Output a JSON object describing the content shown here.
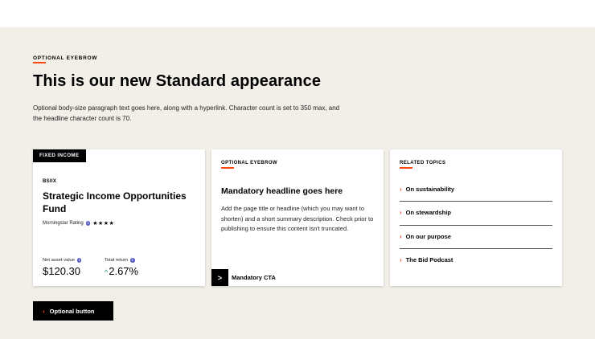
{
  "section": {
    "eyebrow": "OPTIONAL EYEBROW",
    "headline": "This is our new Standard appearance",
    "body": "Optional body-size paragraph text goes here, along with a hyperlink. Character count is set to 350 max, and the headline character count is 70."
  },
  "fund_card": {
    "tag": "FIXED INCOME",
    "ticker": "BSIIX",
    "name": "Strategic Income Opportunities Fund",
    "rating_label": "Morningstar Rating",
    "rating_stars": "★★★★",
    "rating_value": 4,
    "nav_label": "Net asset value",
    "nav_value": "$120.30",
    "return_label": "Total return",
    "return_value": "2.67%"
  },
  "article_card": {
    "eyebrow": "OPTIONAL EYEBROW",
    "headline": "Mandatory headline goes here",
    "body": "Add the page title or headline (which you may want to shorten) and a short summary description. Check prior to publishing to ensure this content isn't truncated.",
    "cta_label": "Mandatory CTA"
  },
  "topics_card": {
    "eyebrow": "RELATED TOPICS",
    "items": [
      {
        "label": "On sustainability"
      },
      {
        "label": "On stewardship"
      },
      {
        "label": "On our purpose"
      },
      {
        "label": "The Bid Podcast"
      }
    ]
  },
  "optional_button": {
    "label": "Optional button"
  },
  "colors": {
    "accent": "#ff4713",
    "background": "#f2efe9",
    "info": "#5b5fc7",
    "positive": "#1a9f6e"
  }
}
